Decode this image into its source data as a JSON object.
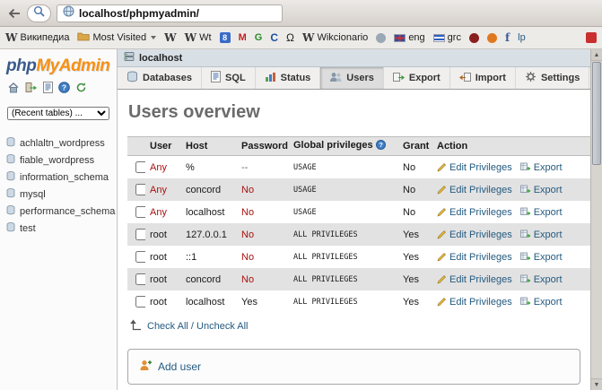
{
  "browser": {
    "url": "localhost/phpmyadmin/",
    "bookmarks": [
      {
        "glyph": "W",
        "label": "Википедиа"
      },
      {
        "label": "Most Visited"
      },
      {
        "glyph": "W",
        "label": ""
      },
      {
        "glyph": "W",
        "label": "Wt"
      },
      {
        "glyph": "8",
        "label": ""
      },
      {
        "glyph": "M",
        "label": ""
      },
      {
        "glyph": "G",
        "label": ""
      },
      {
        "glyph": "C",
        "label": ""
      },
      {
        "glyph": "Ω",
        "label": ""
      },
      {
        "glyph": "W",
        "label": "Wikcionario"
      },
      {
        "label": ""
      },
      {
        "label": "eng"
      },
      {
        "label": "grc"
      },
      {
        "label": ""
      },
      {
        "label": ""
      },
      {
        "glyph": "f",
        "label": ""
      },
      {
        "label": "lp"
      },
      {
        "label": ""
      }
    ]
  },
  "phpmyadmin": {
    "logo_php": "php",
    "logo_myadmin": "MyAdmin",
    "recent_tables_placeholder": "(Recent tables) ...",
    "databases": [
      "achlaltn_wordpress",
      "fiable_wordpress",
      "information_schema",
      "mysql",
      "performance_schema",
      "test"
    ],
    "server_name": "localhost",
    "tabs": [
      {
        "label": "Databases"
      },
      {
        "label": "SQL"
      },
      {
        "label": "Status"
      },
      {
        "label": "Users",
        "active": true
      },
      {
        "label": "Export"
      },
      {
        "label": "Import"
      },
      {
        "label": "Settings"
      }
    ],
    "page_title": "Users overview",
    "users_table": {
      "headers": {
        "user": "User",
        "host": "Host",
        "password": "Password",
        "privileges": "Global privileges",
        "grant": "Grant",
        "action": "Action"
      },
      "rows": [
        {
          "user": "Any",
          "host": "%",
          "password": "--",
          "privileges": "USAGE",
          "grant": "No"
        },
        {
          "user": "Any",
          "host": "concord",
          "password": "No",
          "privileges": "USAGE",
          "grant": "No"
        },
        {
          "user": "Any",
          "host": "localhost",
          "password": "No",
          "privileges": "USAGE",
          "grant": "No"
        },
        {
          "user": "root",
          "host": "127.0.0.1",
          "password": "No",
          "privileges": "ALL PRIVILEGES",
          "grant": "Yes"
        },
        {
          "user": "root",
          "host": "::1",
          "password": "No",
          "privileges": "ALL PRIVILEGES",
          "grant": "Yes"
        },
        {
          "user": "root",
          "host": "concord",
          "password": "No",
          "privileges": "ALL PRIVILEGES",
          "grant": "Yes"
        },
        {
          "user": "root",
          "host": "localhost",
          "password": "Yes",
          "privileges": "ALL PRIVILEGES",
          "grant": "Yes"
        }
      ],
      "edit_label": "Edit Privileges",
      "export_label": "Export",
      "check_all_label": "Check All / Uncheck All",
      "add_user_label": "Add user"
    },
    "colors": {
      "link_blue": "#235a81",
      "logo_orange": "#f79112",
      "warning_red": "#aa1111"
    }
  }
}
